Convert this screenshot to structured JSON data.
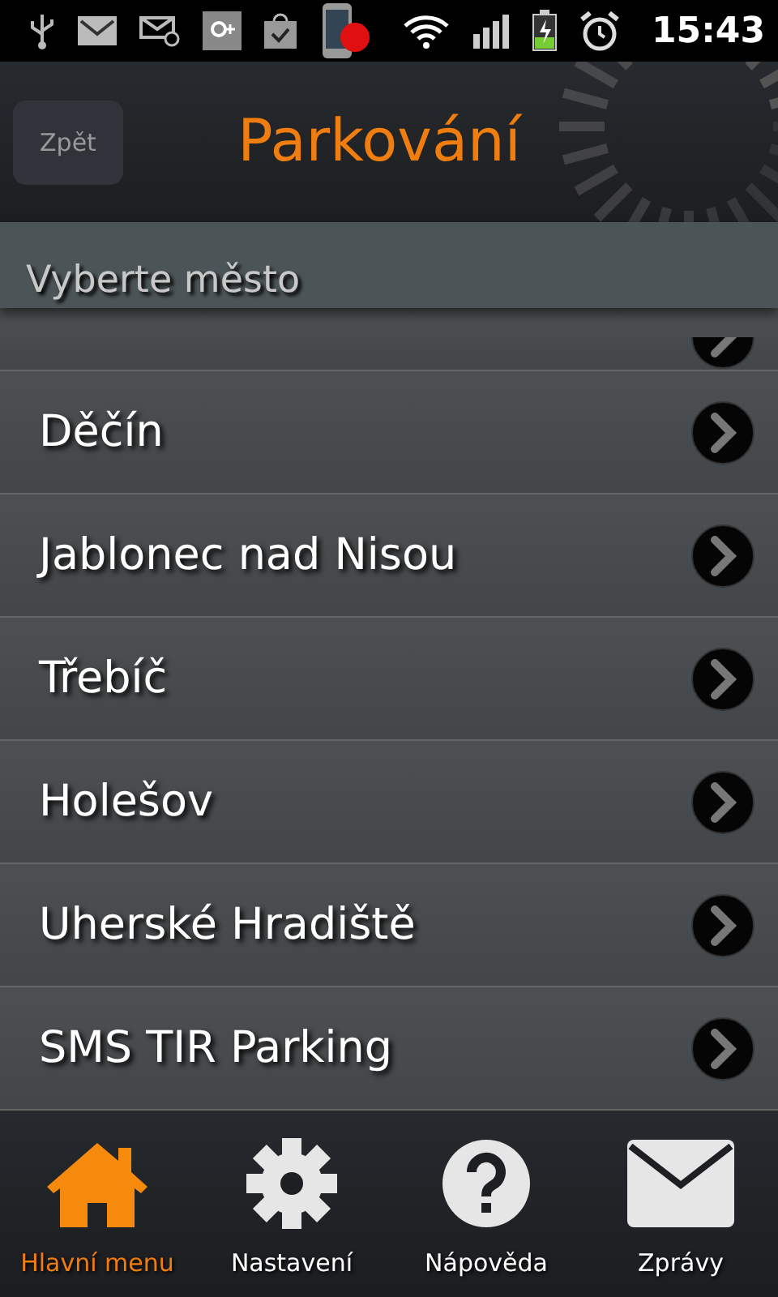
{
  "status_bar": {
    "time": "15:43"
  },
  "header": {
    "back": "Zpět",
    "title": "Parkování"
  },
  "section_title": "Vyberte město",
  "cities": [
    {
      "label": "Děčín"
    },
    {
      "label": "Jablonec nad Nisou"
    },
    {
      "label": "Třebíč"
    },
    {
      "label": "Holešov"
    },
    {
      "label": "Uherské Hradiště"
    },
    {
      "label": "SMS TIR Parking"
    }
  ],
  "nav": [
    {
      "kind": "home",
      "label": "Hlavní menu",
      "selected": true
    },
    {
      "kind": "settings",
      "label": "Nastavení",
      "selected": false
    },
    {
      "kind": "help",
      "label": "Nápověda",
      "selected": false
    },
    {
      "kind": "messages",
      "label": "Zprávy",
      "selected": false
    }
  ]
}
